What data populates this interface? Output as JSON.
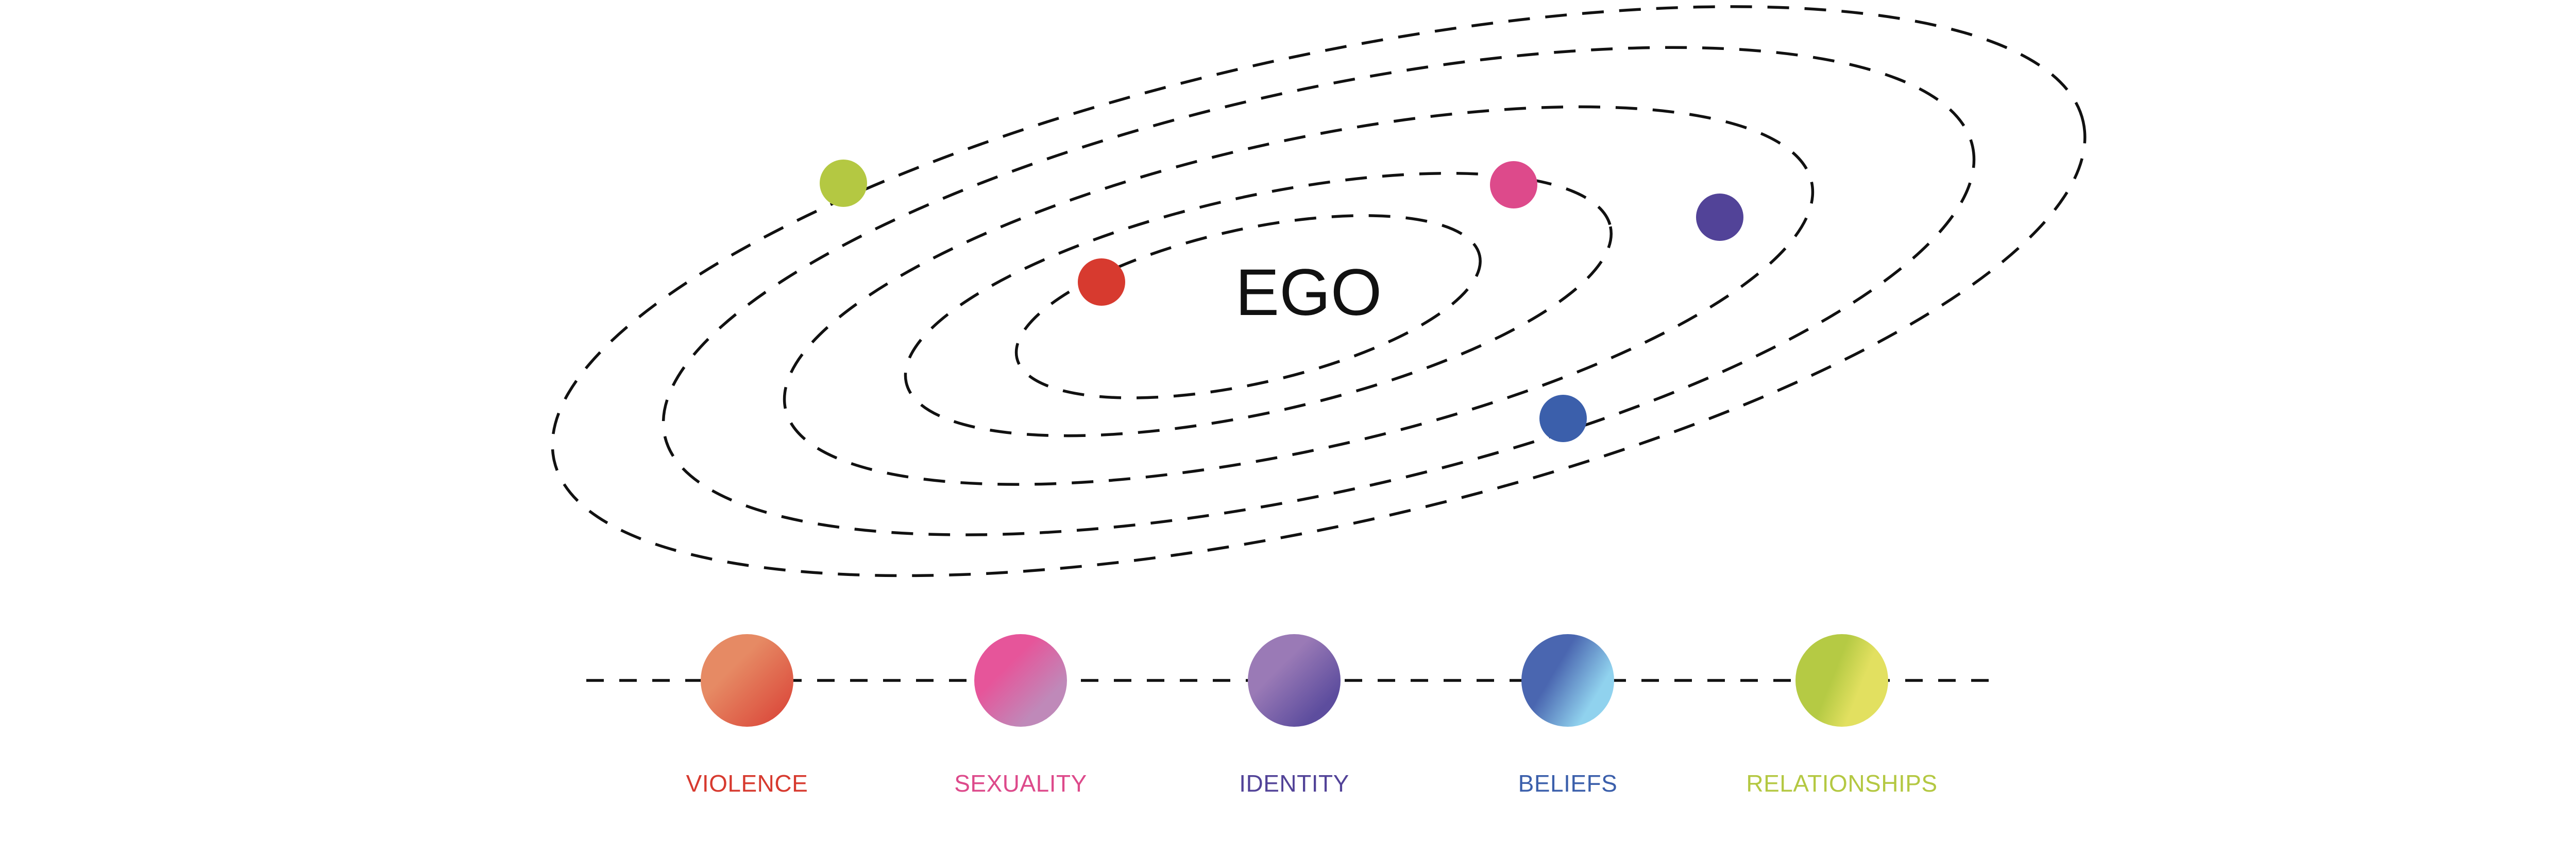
{
  "center": {
    "label": "EGO"
  },
  "colors": {
    "violence": "#d73a2f",
    "sexuality": "#dd4a8b",
    "identity": "#524398",
    "beliefs": "#3b5fab",
    "relationships": "#b4c842"
  },
  "orbit_count": 5,
  "planets": [
    {
      "name": "violence",
      "color": "#d73a2f"
    },
    {
      "name": "sexuality",
      "color": "#dd4a8b"
    },
    {
      "name": "identity",
      "color": "#524398"
    },
    {
      "name": "beliefs",
      "color": "#3b5fab"
    },
    {
      "name": "relationships",
      "color": "#b4c842"
    }
  ],
  "categories": [
    {
      "label": "VIOLENCE",
      "color": "#d73a2f",
      "gradient": [
        "#e68a64",
        "#d93e34"
      ]
    },
    {
      "label": "SEXUALITY",
      "color": "#dd4a8b",
      "gradient": [
        "#e6559a",
        "#bf89b9"
      ]
    },
    {
      "label": "IDENTITY",
      "color": "#524398",
      "gradient": [
        "#9a7ab6",
        "#5d4d9e"
      ]
    },
    {
      "label": "BELIEFS",
      "color": "#3b5fab",
      "gradient": [
        "#4a66b0",
        "#90d2ee"
      ]
    },
    {
      "label": "RELATIONSHIPS",
      "color": "#b4c842",
      "gradient": [
        "#b5ca44",
        "#e2e060"
      ]
    }
  ]
}
